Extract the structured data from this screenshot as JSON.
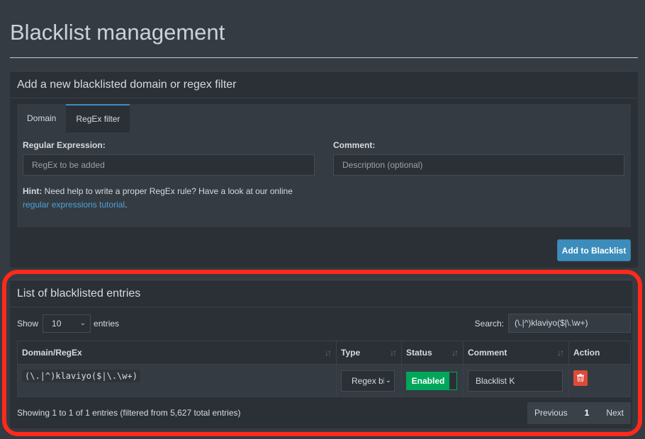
{
  "page": {
    "title": "Blacklist management"
  },
  "add_box": {
    "header": "Add a new blacklisted domain or regex filter",
    "tabs": [
      {
        "label": "Domain"
      },
      {
        "label": "RegEx filter"
      }
    ],
    "regex_label": "Regular Expression:",
    "regex_placeholder": "RegEx to be added",
    "comment_label": "Comment:",
    "comment_placeholder": "Description (optional)",
    "hint_bold": "Hint:",
    "hint_text": " Need help to write a proper RegEx rule? Have a look at our online ",
    "hint_link": "regular expressions tutorial",
    "hint_end": ".",
    "add_button": "Add to Blacklist"
  },
  "list_box": {
    "header": "List of blacklisted entries",
    "show_label": "Show",
    "entries_per_page": "10",
    "entries_label": "entries",
    "search_label": "Search:",
    "search_value": "(\\.|^)klaviyo($|\\.\\w+)",
    "columns": [
      "Domain/RegEx",
      "Type",
      "Status",
      "Comment",
      "Action"
    ],
    "rows": [
      {
        "domain": "(\\.|^)klaviyo($|\\.\\w+)",
        "type": "Regex bl",
        "status": "Enabled",
        "comment": "Blacklist K"
      }
    ],
    "info": "Showing 1 to 1 of 1 entries (filtered from 5,627 total entries)",
    "pager": {
      "prev": "Previous",
      "current": "1",
      "next": "Next"
    }
  },
  "colors": {
    "primary": "#3c8dbc",
    "success": "#00a65a",
    "danger": "#dd4b39",
    "highlight": "#ff2a1a"
  },
  "icons": [
    "sort-icon",
    "chevron-down-icon",
    "trash-icon"
  ]
}
